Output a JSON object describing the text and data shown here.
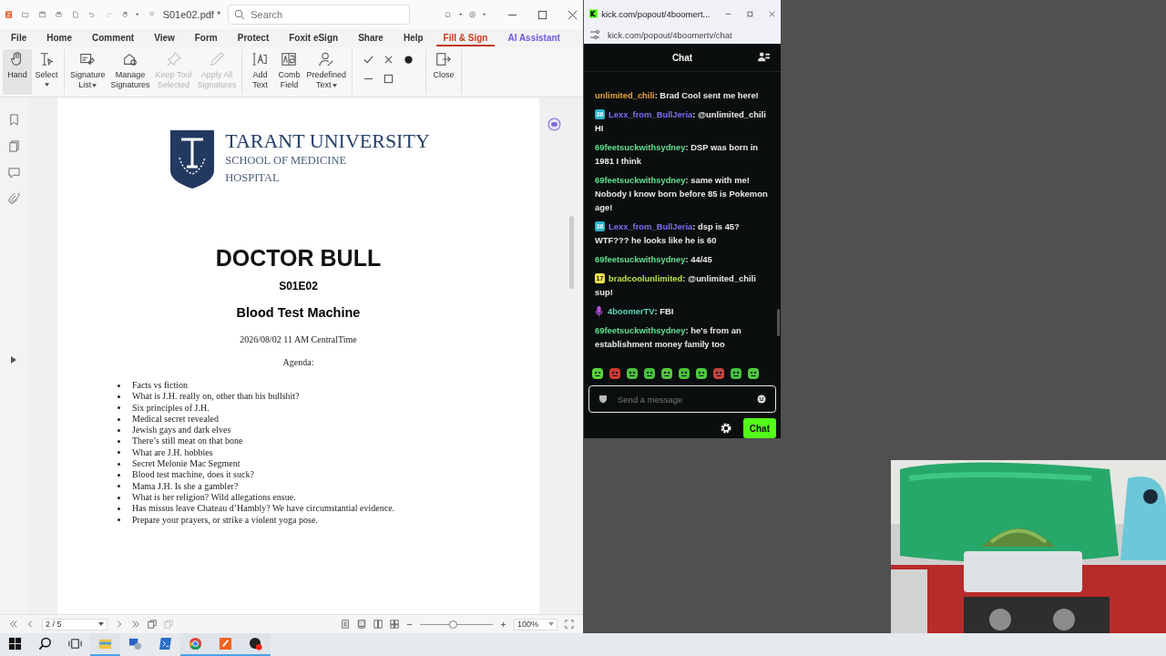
{
  "pdf_app": {
    "file_name": "S01e02.pdf *",
    "search": {
      "placeholder": "Search"
    },
    "menu_tabs": [
      {
        "label": "File",
        "selected": false
      },
      {
        "label": "Home",
        "selected": false
      },
      {
        "label": "Comment",
        "selected": false
      },
      {
        "label": "View",
        "selected": false
      },
      {
        "label": "Form",
        "selected": false
      },
      {
        "label": "Protect",
        "selected": false
      },
      {
        "label": "Foxit eSign",
        "selected": false
      },
      {
        "label": "Share",
        "selected": false
      },
      {
        "label": "Help",
        "selected": false
      },
      {
        "label": "Fill & Sign",
        "selected": true
      },
      {
        "label": "AI Assistant",
        "selected": false
      }
    ],
    "ribbon_groups": [
      {
        "kind": "buttons",
        "items": [
          {
            "lines": [
              "Hand"
            ],
            "selected": true,
            "disabled": false,
            "dropdown": false
          },
          {
            "lines": [
              "Select"
            ],
            "selected": false,
            "disabled": false,
            "dropdown": true
          }
        ]
      },
      {
        "kind": "buttons",
        "items": [
          {
            "lines": [
              "Signature",
              "List"
            ],
            "selected": false,
            "disabled": false,
            "dropdown": true
          },
          {
            "lines": [
              "Manage",
              "Signatures"
            ],
            "selected": false,
            "disabled": false,
            "dropdown": false
          },
          {
            "lines": [
              "Keep Tool",
              "Selected"
            ],
            "selected": false,
            "disabled": true,
            "dropdown": false
          },
          {
            "lines": [
              "Apply All",
              "Signatures"
            ],
            "selected": false,
            "disabled": true,
            "dropdown": false
          }
        ]
      },
      {
        "kind": "buttons",
        "items": [
          {
            "lines": [
              "Add",
              "Text"
            ],
            "selected": false,
            "disabled": false,
            "dropdown": false
          },
          {
            "lines": [
              "Comb",
              "Field"
            ],
            "selected": false,
            "disabled": false,
            "dropdown": false
          },
          {
            "lines": [
              "Predefined",
              "Text"
            ],
            "selected": false,
            "disabled": false,
            "dropdown": true
          }
        ]
      },
      {
        "kind": "marks"
      },
      {
        "kind": "buttons",
        "items": [
          {
            "lines": [
              "Close"
            ],
            "selected": false,
            "disabled": false,
            "dropdown": false
          }
        ]
      }
    ],
    "document": {
      "logo": {
        "name": "TARANT UNIVERSITY",
        "line_2": "SCHOOL OF MEDICINE",
        "line_3": "HOSPITAL"
      },
      "title": "DOCTOR BULL",
      "episode": "S01E02",
      "subtitle": "Blood Test Machine",
      "datetime": "2026/08/02 11 AM CentralTime",
      "agenda_heading": "Agenda:",
      "agenda": [
        "Facts vs fiction",
        "What is J.H. really on, other than his bullshit?",
        "Six principles of J.H.",
        "Medical secret revealed",
        "Jewish gays and dark elves",
        "There’s still meat on that bone",
        "What are J.H. hobbies",
        "Secret Melonie Mac Segment",
        "Blood test machine, does it suck?",
        "Mama J.H. Is she a gambler?",
        "What is her religion? Wild allegations ensue.",
        "Has missus leave Chateau d’Hambly? We have circumstantial evidence.",
        "Prepare your prayers, or strike a violent yoga pose."
      ]
    },
    "status_bar": {
      "page": "2 / 5",
      "zoom": {
        "level": 0.45,
        "reading": "100%"
      }
    }
  },
  "chat_window": {
    "tab_title": "kick.com/popout/4boomert...",
    "url": "kick.com/popout/4boomertv/chat",
    "header": "Chat",
    "messages": [
      {
        "user": "unlimited_chili",
        "color": "#e8a33c",
        "lines": [
          ": Brad Cool sent me here!"
        ]
      },
      {
        "badge": {
          "kind": "subscriber",
          "text": "36"
        },
        "user": "Lexx_from_BullJeria",
        "color": "#7d6ff0",
        "lines": [
          ": @unlimited_chili",
          "HI"
        ]
      },
      {
        "user": "69feetsuckwithsydney",
        "color": "#63e08e",
        "lines": [
          ": DSP was born in",
          "1981 I think"
        ]
      },
      {
        "user": "69feetsuckwithsydney",
        "color": "#63e08e",
        "lines": [
          ": same with me!",
          "Nobody I know born before 85 is Pokemon",
          "age!"
        ]
      },
      {
        "badge": {
          "kind": "subscriber",
          "text": "36"
        },
        "user": "Lexx_from_BullJeria",
        "color": "#7d6ff0",
        "lines": [
          ": dsp is 45?",
          "WTF??? he looks like he is 60"
        ]
      },
      {
        "user": "69feetsuckwithsydney",
        "color": "#63e08e",
        "lines": [
          ": 44/45"
        ]
      },
      {
        "badge": {
          "kind": "gifter",
          "text": "17"
        },
        "user": "bradcoolunlimited",
        "color": "#b9e34a",
        "lines": [
          ": @unlimited_chili",
          "sup!"
        ]
      },
      {
        "badge": {
          "kind": "broadcaster"
        },
        "user": "4boomerTV",
        "color": "#5fd6b4",
        "lines": [
          ": FBI"
        ]
      },
      {
        "user": "69feetsuckwithsydney",
        "color": "#63e08e",
        "lines": [
          ": he's from an",
          "establishment money family too"
        ]
      }
    ],
    "input": {
      "placeholder": "Send a message"
    },
    "send_button": "Chat"
  },
  "taskbar": [
    {
      "kind": "start",
      "open": false
    },
    {
      "kind": "search",
      "open": false
    },
    {
      "kind": "taskview",
      "open": false
    },
    {
      "kind": "folder",
      "open": true
    },
    {
      "kind": "network",
      "open": false
    },
    {
      "kind": "terminal",
      "open": false
    },
    {
      "kind": "browser",
      "open": true
    },
    {
      "kind": "reader",
      "open": true
    },
    {
      "kind": "recorder",
      "open": true
    }
  ]
}
